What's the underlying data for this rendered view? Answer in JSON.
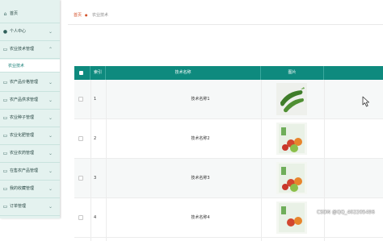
{
  "sidebar": {
    "items": [
      {
        "label": "首页",
        "icon": "home-icon"
      },
      {
        "label": "个人中心",
        "icon": "user-icon"
      },
      {
        "label": "农业技术管理",
        "icon": "chat-icon"
      },
      {
        "label": "农产品价格管理",
        "icon": "chat-icon"
      },
      {
        "label": "农产品供求管理",
        "icon": "chat-icon"
      },
      {
        "label": "农业种子管理",
        "icon": "chat-icon"
      },
      {
        "label": "农业化肥管理",
        "icon": "chat-icon"
      },
      {
        "label": "农业农药管理",
        "icon": "chat-icon"
      },
      {
        "label": "在售农产品管理",
        "icon": "chat-icon"
      },
      {
        "label": "我的收藏管理",
        "icon": "chat-icon"
      },
      {
        "label": "订单管理",
        "icon": "chat-icon"
      }
    ],
    "sub_item": "农业技术"
  },
  "breadcrumb": {
    "home": "首页",
    "current": "农业技术"
  },
  "table": {
    "headers": [
      "索引",
      "技术名称",
      "图片"
    ],
    "rows": [
      {
        "index": "1",
        "name": "技术名称1"
      },
      {
        "index": "2",
        "name": "技术名称2"
      },
      {
        "index": "3",
        "name": "技术名称3"
      },
      {
        "index": "4",
        "name": "技术名称4"
      }
    ]
  },
  "watermark": "CSDN @QQ_402205496",
  "colors": {
    "accent": "#0e8a7e",
    "sidebar_bg": "#e4f2ef",
    "breadcrumb_home": "#d4532b"
  }
}
